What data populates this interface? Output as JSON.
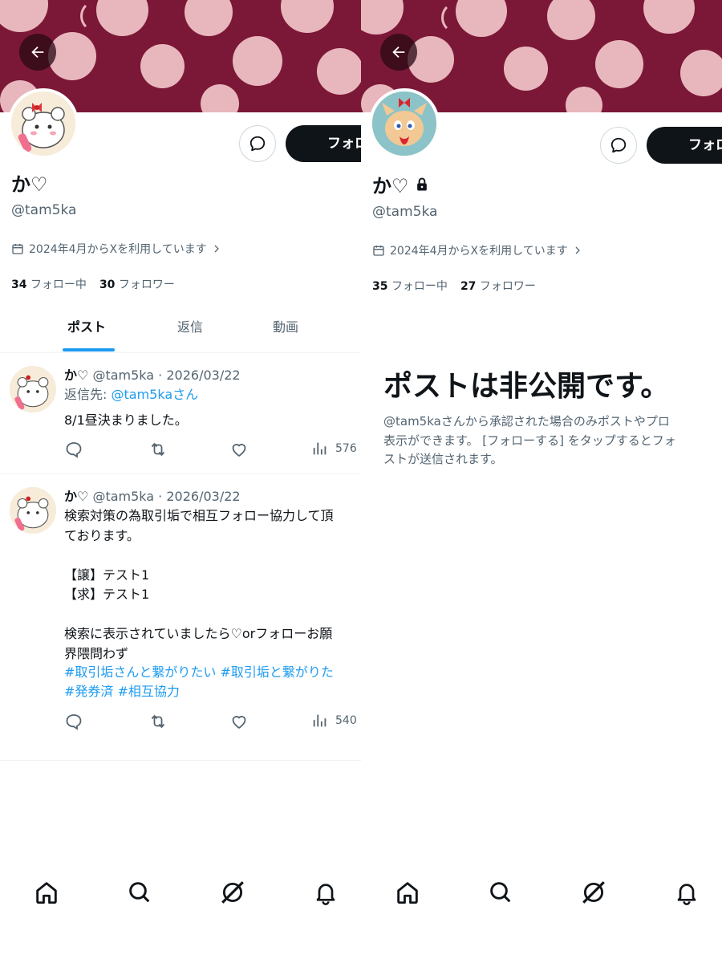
{
  "left": {
    "profile": {
      "display_name": "か♡",
      "handle": "@tam5ka",
      "joined": "2024年4月からXを利用しています",
      "following_count": "34",
      "following_label": "フォロー中",
      "followers_count": "30",
      "followers_label": "フォロワー",
      "follow_button": "フォロー"
    },
    "tabs": [
      "ポスト",
      "返信",
      "動画"
    ],
    "posts": [
      {
        "name": "か♡",
        "meta": "@tam5ka · 2026/03/22",
        "reply_label": "返信先: ",
        "reply_to": "@tam5kaさん",
        "text": "8/1昼決まりました。",
        "views": "576"
      },
      {
        "name": "か♡",
        "meta": "@tam5ka · 2026/03/22",
        "text": "検索対策の為取引垢で相互フォロー協力して頂\nております。\n\n【譲】テスト1\n【求】テスト1\n\n検索に表示されていましたら♡orフォローお願\n界隈問わず",
        "hashtags_line1": "#取引垢さんと繋がりたい #取引垢と繋がりた",
        "hashtags_line2": "#発券済 #相互協力",
        "views": "540"
      }
    ]
  },
  "right": {
    "profile": {
      "display_name": "か♡",
      "handle": "@tam5ka",
      "joined": "2024年4月からXを利用しています",
      "following_count": "35",
      "following_label": "フォロー中",
      "followers_count": "27",
      "followers_label": "フォロワー",
      "follow_button": "フォロー"
    },
    "private_title": "ポストは非公開です。",
    "private_desc": "@tam5kaさんから承認された場合のみポストやプロ\n表示ができます。 [フォローする] をタップするとフォ\nストが送信されます。"
  },
  "nav": [
    "home-icon",
    "search-icon",
    "grok-icon",
    "notifications-icon"
  ],
  "colors": {
    "accent": "#1d9bf0",
    "banner": "#7c1837",
    "cherry": "#e8b7bd",
    "text": "#0f1419",
    "muted": "#536471"
  }
}
